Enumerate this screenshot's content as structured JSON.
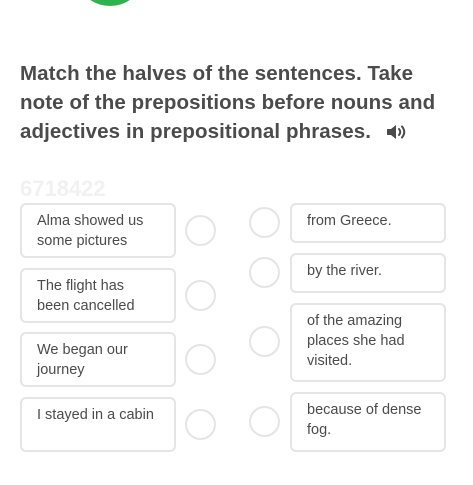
{
  "instruction": {
    "text": "Match the halves of the sentences. Take note of the prepositions before nouns and adjectives in prepositional phrases.",
    "audio_icon": "speaker-icon"
  },
  "watermark": "6718422",
  "left_items": [
    {
      "text": "Alma showed us some pictures"
    },
    {
      "text": "The flight has been cancelled"
    },
    {
      "text": "We began our journey"
    },
    {
      "text": "I stayed in a cabin"
    }
  ],
  "right_items": [
    {
      "text": "from Greece."
    },
    {
      "text": "by the river."
    },
    {
      "text": "of the amazing places she had visited."
    },
    {
      "text": "because of dense fog."
    }
  ],
  "colors": {
    "accent_green": "#2fb34f",
    "border": "#e5e5e5",
    "text": "#4b4b4b"
  }
}
